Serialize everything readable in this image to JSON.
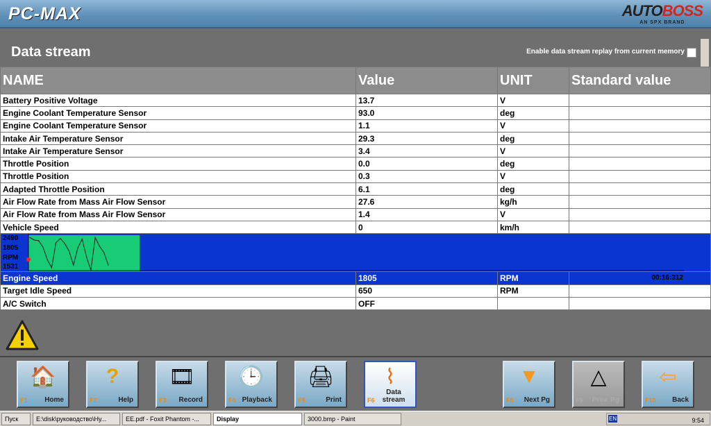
{
  "header": {
    "app_title": "PC-MAX",
    "brand_a": "AUTO",
    "brand_b": "BOSS",
    "brand_sub": "AN SPX BRAND"
  },
  "page": {
    "title": "Data stream",
    "replay_label": "Enable data stream replay from current memory"
  },
  "table": {
    "columns": [
      "NAME",
      "Value",
      "UNIT",
      "Standard value"
    ],
    "rows_top": [
      {
        "name": "Battery Positive Voltage",
        "value": "13.7",
        "unit": "V",
        "std": ""
      },
      {
        "name": "Engine Coolant Temperature Sensor",
        "value": "93.0",
        "unit": "deg",
        "std": ""
      },
      {
        "name": "Engine Coolant Temperature Sensor",
        "value": "1.1",
        "unit": "V",
        "std": ""
      },
      {
        "name": "Intake Air Temperature Sensor",
        "value": "29.3",
        "unit": "deg",
        "std": ""
      },
      {
        "name": "Intake Air Temperature Sensor",
        "value": "3.4",
        "unit": "V",
        "std": ""
      },
      {
        "name": "Throttle Position",
        "value": "0.0",
        "unit": "deg",
        "std": ""
      },
      {
        "name": "Throttle Position",
        "value": "0.3",
        "unit": "V",
        "std": ""
      },
      {
        "name": "Adapted Throttle Position",
        "value": "6.1",
        "unit": "deg",
        "std": ""
      },
      {
        "name": "Air Flow Rate from Mass Air Flow Sensor",
        "value": "27.6",
        "unit": "kg/h",
        "std": ""
      },
      {
        "name": "Air Flow Rate from Mass Air Flow Sensor",
        "value": "1.4",
        "unit": "V",
        "std": ""
      },
      {
        "name": "Vehicle Speed",
        "value": "0",
        "unit": "km/h",
        "std": ""
      }
    ],
    "selected": {
      "name": "Engine Speed",
      "value": "1805",
      "unit": "RPM",
      "std": ""
    },
    "rows_bottom": [
      {
        "name": "Target Idle Speed",
        "value": "650",
        "unit": "RPM",
        "std": ""
      },
      {
        "name": "A/C Switch",
        "value": "OFF",
        "unit": "",
        "std": ""
      }
    ]
  },
  "chart_data": {
    "type": "line",
    "title": "Engine Speed",
    "ylabel": "RPM",
    "max_label": "2490",
    "current_label": "1805",
    "min_label": "1531",
    "unit_label": "RPM",
    "time_label": "00:16:312",
    "ylim": [
      1500,
      2560
    ],
    "values": [
      2530,
      2450,
      2430,
      2230,
      1830,
      1570,
      2370,
      2500,
      2340,
      2100,
      1650,
      2200,
      2480,
      1910,
      1500,
      2530,
      2250,
      2050,
      1650
    ],
    "colors": {
      "plot_bg": "#17cc74",
      "line": "#1a1a1a",
      "panel": "#0a35d0",
      "marker": "#ff2020"
    }
  },
  "buttons": [
    {
      "key": "F1",
      "label": "Home",
      "icon": "home-icon",
      "glyph": "🏠"
    },
    {
      "key": "F2",
      "label": "Help",
      "icon": "help-icon",
      "glyph": "?"
    },
    {
      "key": "F3",
      "label": "Record",
      "icon": "record-icon",
      "glyph": "🎞"
    },
    {
      "key": "F4",
      "label": "Playback",
      "icon": "playback-icon",
      "glyph": "🕒"
    },
    {
      "key": "F5",
      "label": "Print",
      "icon": "print-icon",
      "glyph": "🖨"
    },
    {
      "key": "F6",
      "label": "Data stream",
      "icon": "data-stream-icon",
      "glyph": "⌇"
    },
    {
      "key": "F8",
      "label": "Next Pg",
      "icon": "next-page-icon",
      "glyph": "▼"
    },
    {
      "key": "F9",
      "label": "Prev. Pg",
      "icon": "prev-page-icon",
      "glyph": "△"
    },
    {
      "key": "F10",
      "label": "Back",
      "icon": "back-icon",
      "glyph": "⇦"
    }
  ],
  "taskbar": {
    "start": "Пуск",
    "items": [
      "E:\\disk\\руководство\\Ну...",
      "EE.pdf - Foxit Phantom -...",
      "Display",
      "3000.bmp - Paint"
    ],
    "lang": "EN",
    "time": "9:54"
  }
}
